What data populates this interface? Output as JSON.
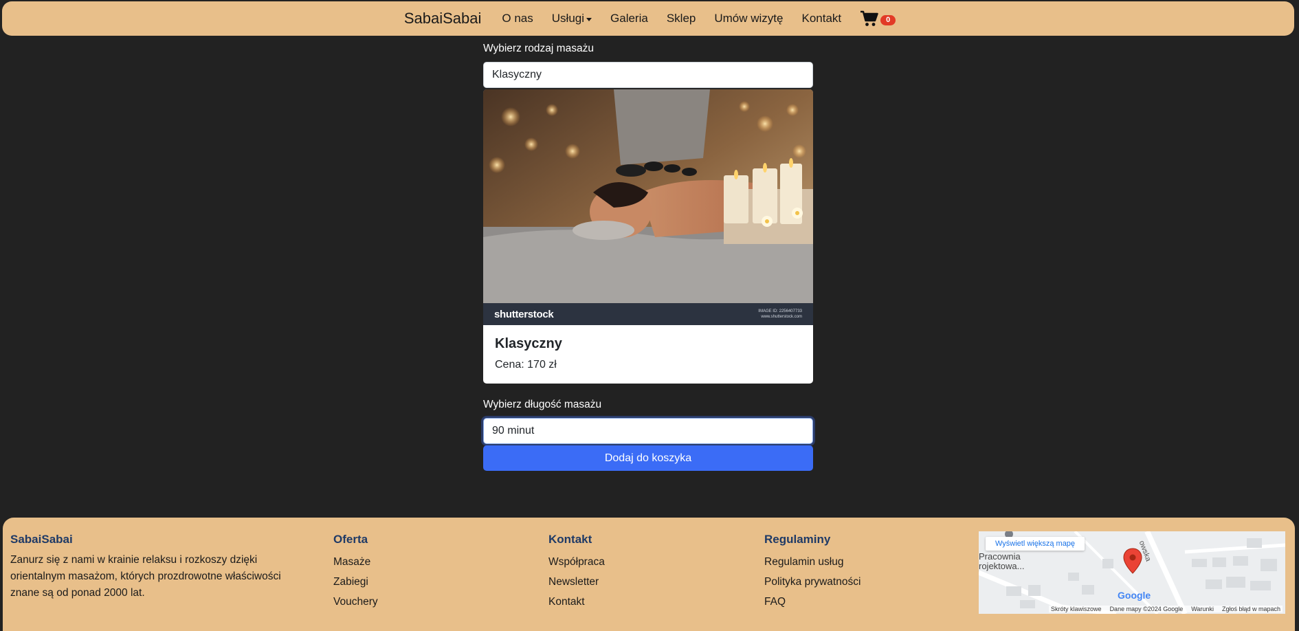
{
  "nav": {
    "brand": "SabaiSabai",
    "links": [
      "O nas",
      "Usługi",
      "Galeria",
      "Sklep",
      "Umów wizytę",
      "Kontakt"
    ],
    "cart_count": "0",
    "cart_icon": "shopping-cart-icon"
  },
  "form": {
    "type_label": "Wybierz rodzaj masażu",
    "type_value": "Klasyczny",
    "card": {
      "image_caption_logo": "shutterstock",
      "image_id_line1": "IMAGE ID: 2256407733",
      "image_id_line2": "www.shutterstock.com",
      "title": "Klasyczny",
      "price": "Cena: 170 zł"
    },
    "length_label": "Wybierz długość masażu",
    "length_value": "90 minut",
    "add_button": "Dodaj do koszyka"
  },
  "footer": {
    "about": {
      "title": "SabaiSabai",
      "text": "Zanurz się z nami w krainie relaksu i rozkoszy dzięki orientalnym masażom, których prozdrowotne właściwości znane są od ponad 2000 lat."
    },
    "offer": {
      "title": "Oferta",
      "links": [
        "Masaże",
        "Zabiegi",
        "Vouchery"
      ]
    },
    "contact": {
      "title": "Kontakt",
      "links": [
        "Współpraca",
        "Newsletter",
        "Kontakt"
      ]
    },
    "rules": {
      "title": "Regulaminy",
      "links": [
        "Regulamin usług",
        "Polityka prywatności",
        "FAQ"
      ]
    },
    "map": {
      "button": "Wyświetl większą mapę",
      "place": "Pracownia\nrojektowa...",
      "street": "owska",
      "logo": "Google",
      "footer_items": [
        "Skróty klawiszowe",
        "Dane mapy ©2024 Google",
        "Warunki",
        "Zgłoś błąd w mapach"
      ]
    }
  },
  "colors": {
    "nav_bg": "#e8bf8a",
    "page_bg": "#222222",
    "button_bg": "#3b6cf6",
    "badge_bg": "#e23a26",
    "footer_title": "#1f3a66"
  }
}
